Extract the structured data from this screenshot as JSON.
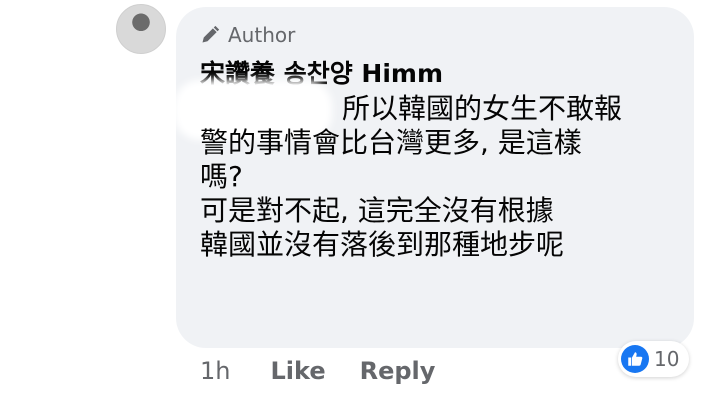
{
  "comment": {
    "author_badge": "Author",
    "author_name": "宋讚養 송찬양 Himm",
    "text_lines": [
      "所以韓國的女生不敢報",
      "警的事情會比台灣更多, 是這樣",
      "嗎?",
      "可是對不起, 這完全沒有根據",
      "韓國並沒有落後到那種地步呢"
    ],
    "time": "1h",
    "like_label": "Like",
    "reply_label": "Reply",
    "reaction_count": "10"
  },
  "icons": {
    "author": "pencil-icon",
    "reaction": "thumbs-up-icon"
  },
  "colors": {
    "bubble_background": "#f0f2f5",
    "text": "#050505",
    "muted_text": "#65676b",
    "reaction_blue": "#1877f2"
  }
}
